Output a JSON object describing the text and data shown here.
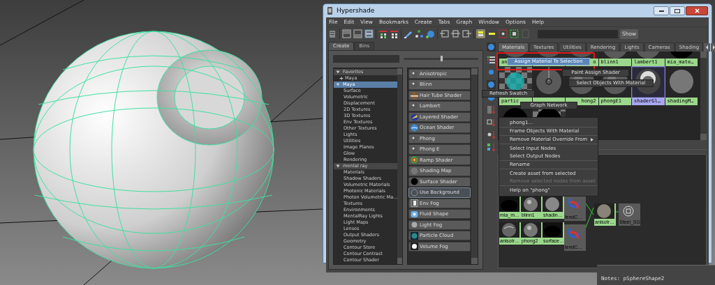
{
  "window": {
    "title": "Hypershade"
  },
  "menu": [
    "File",
    "Edit",
    "View",
    "Bookmarks",
    "Create",
    "Tabs",
    "Graph",
    "Window",
    "Options",
    "Help"
  ],
  "toolbar": {
    "show_button": "Show"
  },
  "create_panel": {
    "tabs": [
      {
        "label": "Create",
        "selected": true
      },
      {
        "label": "Bins",
        "selected": false
      }
    ],
    "slider": {
      "level": 0.5
    },
    "tree": [
      {
        "label": "Favorites",
        "expanded": true,
        "selected": false,
        "children": [
          {
            "label": "Maya",
            "expanded": false,
            "selected": false
          }
        ]
      },
      {
        "label": "Maya",
        "expanded": true,
        "selected": true,
        "children": [
          {
            "label": "Surface"
          },
          {
            "label": "Volumetric"
          },
          {
            "label": "Displacement"
          },
          {
            "label": "2D Textures"
          },
          {
            "label": "3D Textures"
          },
          {
            "label": "Env Textures"
          },
          {
            "label": "Other Textures"
          },
          {
            "label": "Lights"
          },
          {
            "label": "Utilities"
          },
          {
            "label": "Image Planes"
          },
          {
            "label": "Glow"
          },
          {
            "label": "Rendering"
          }
        ]
      },
      {
        "label": "mental ray",
        "expanded": true,
        "selected": false,
        "children": [
          {
            "label": "Materials"
          },
          {
            "label": "Shadow Shaders"
          },
          {
            "label": "Volumetric Materials"
          },
          {
            "label": "Photonic Materials"
          },
          {
            "label": "Photon Volumetric Ma..."
          },
          {
            "label": "Textures"
          },
          {
            "label": "Environments"
          },
          {
            "label": "MentalRay Lights"
          },
          {
            "label": "Light Maps"
          },
          {
            "label": "Lenses"
          },
          {
            "label": "Output Shaders"
          },
          {
            "label": "Geometry"
          },
          {
            "label": "Contour Store"
          },
          {
            "label": "Contour Contrast"
          },
          {
            "label": "Contour Shader"
          }
        ]
      }
    ],
    "shaders": [
      {
        "label": "Anisotropic",
        "kind": "ball",
        "selected": false
      },
      {
        "label": "Blinn",
        "kind": "ball",
        "selected": false
      },
      {
        "label": "Hair Tube Shader",
        "kind": "hair",
        "selected": false
      },
      {
        "label": "Lambert",
        "kind": "ball",
        "selected": false
      },
      {
        "label": "Layered Shader",
        "kind": "layered",
        "selected": false
      },
      {
        "label": "Ocean Shader",
        "kind": "ocean",
        "selected": false
      },
      {
        "label": "Phong",
        "kind": "ball",
        "selected": false
      },
      {
        "label": "Phong E",
        "kind": "ball",
        "selected": false
      },
      {
        "label": "Ramp Shader",
        "kind": "ramp",
        "selected": false
      },
      {
        "label": "Shading Map",
        "kind": "flat",
        "selected": false
      },
      {
        "label": "Surface Shader",
        "kind": "black",
        "selected": false
      },
      {
        "label": "Use Background",
        "kind": "ring",
        "selected": true
      },
      {
        "label": "Env Fog",
        "kind": "envfog",
        "selected": false
      },
      {
        "label": "Fluid Shape",
        "kind": "fluid",
        "selected": false
      },
      {
        "label": "Light Fog",
        "kind": "lightfog",
        "selected": false
      },
      {
        "label": "Particle Cloud",
        "kind": "particle",
        "selected": false
      },
      {
        "label": "Volume Fog",
        "kind": "volume",
        "selected": false
      }
    ]
  },
  "browser": {
    "tabs": [
      {
        "label": "Materials",
        "selected": true
      },
      {
        "label": "Textures",
        "selected": false
      },
      {
        "label": "Utilities",
        "selected": false
      },
      {
        "label": "Rendering",
        "selected": false
      },
      {
        "label": "Lights",
        "selected": false
      },
      {
        "label": "Cameras",
        "selected": false
      },
      {
        "label": "Shading",
        "selected": false
      }
    ],
    "swatch_rows": [
      [
        {
          "kind": "dark",
          "label": "an"
        },
        {
          "kind": "dark"
        },
        {
          "kind": "dark",
          "label": "o"
        },
        {
          "kind": "sphere",
          "label": "blinn1"
        },
        {
          "kind": "sphere",
          "label": "lambert1"
        },
        {
          "kind": "black",
          "label": "mia_mate…"
        }
      ],
      [
        {
          "kind": "checker-glow",
          "label": "partic"
        },
        {
          "kind": "sphere-handle"
        },
        {
          "kind": "sphere",
          "label": "hong2"
        },
        {
          "kind": "sphere",
          "label": "phongE1"
        },
        {
          "kind": "shiny",
          "label": "shaderGl…",
          "selected": true
        },
        {
          "kind": "disc",
          "label": "shadingM…"
        }
      ],
      [
        {
          "kind": "black"
        },
        {
          "kind": "checker-black"
        }
      ]
    ]
  },
  "popups": [
    {
      "label": "Assign Material To Selection",
      "highlighted": true
    },
    {
      "label": "Paint Assign Shader",
      "highlighted": false
    },
    {
      "label": "Select Objects With Material",
      "highlighted": false
    },
    {
      "label": "Refresh Swatch",
      "highlighted": false
    },
    {
      "label": "Graph Network",
      "highlighted": false
    }
  ],
  "context_menu": [
    {
      "label": "phong1...",
      "disabled": false,
      "submenu": false
    },
    {
      "label": "Frame Objects With Material",
      "disabled": false,
      "submenu": false
    },
    {
      "label": "Remove Material Override From",
      "disabled": false,
      "submenu": true
    },
    {
      "label": "Select Input Nodes",
      "disabled": false,
      "submenu": false
    },
    {
      "label": "Select Output Nodes",
      "disabled": false,
      "submenu": false
    },
    {
      "label": "Rename",
      "disabled": false,
      "submenu": false
    },
    {
      "label": "Create asset from selected",
      "disabled": false,
      "submenu": false
    },
    {
      "label": "Remove selected nodes from asset",
      "disabled": true,
      "submenu": false
    },
    {
      "label": "Help on \"phong\"",
      "disabled": false,
      "submenu": false
    }
  ],
  "graph_nodes": [
    {
      "label": "mia_m…",
      "kind": "black"
    },
    {
      "label": "blinn1",
      "kind": "sphere"
    },
    {
      "label": "shadin…",
      "kind": "flat"
    },
    {
      "label": "lendC…",
      "kind": "blend"
    },
    {
      "label": "anisotr…",
      "kind": "anis"
    },
    {
      "label": "phong2",
      "kind": "sphere"
    },
    {
      "label": "surface…",
      "kind": "black"
    },
    {
      "label": "lendC…",
      "kind": "blend"
    },
    {
      "label": "anisotr…",
      "kind": "wood"
    },
    {
      "label": "Steel_SG",
      "kind": "sg"
    }
  ],
  "notes": {
    "label": "Notes: pSphereShape2"
  }
}
